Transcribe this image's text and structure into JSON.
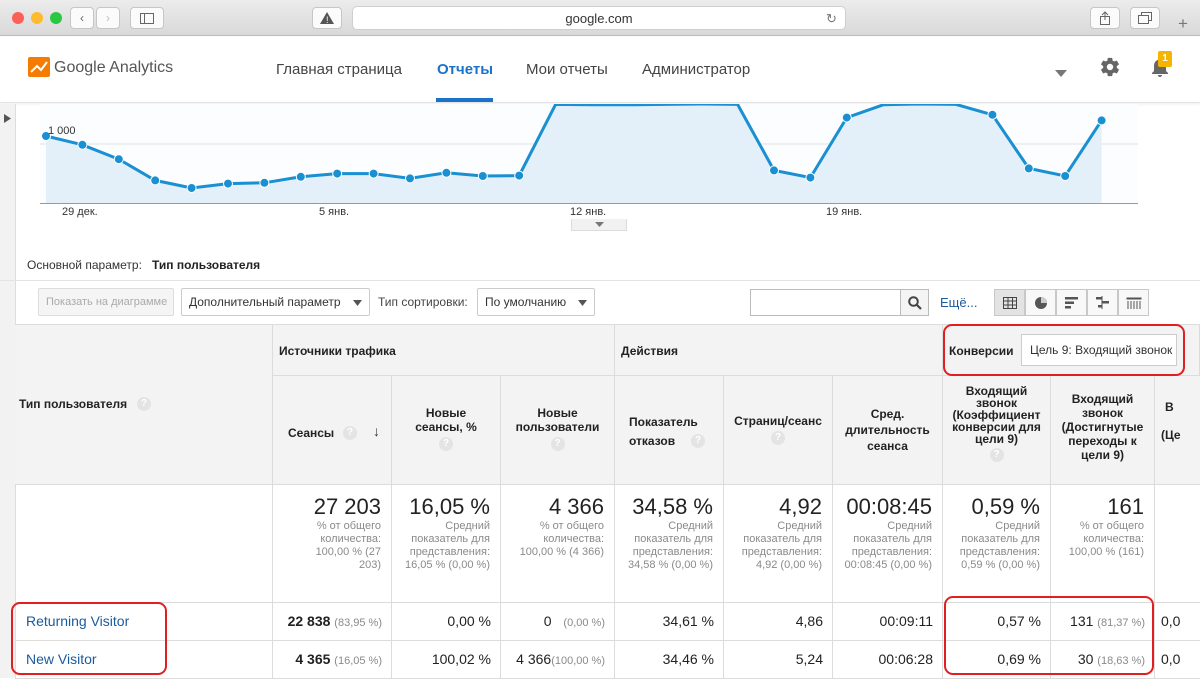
{
  "browser": {
    "url": "google.com"
  },
  "header": {
    "logo_text": "Google Analytics",
    "nav": [
      "Главная страница",
      "Отчеты",
      "Мои отчеты",
      "Администратор"
    ],
    "active_nav": "Отчеты",
    "notification_count": "1"
  },
  "chart_data": {
    "type": "line",
    "x_tick_labels": [
      "29 дек.",
      "5 янв.",
      "12 янв.",
      "19 янв."
    ],
    "y_tick_labels": [
      "1 000"
    ],
    "series": [
      {
        "values": [
          1020,
          998,
          962,
          909,
          890,
          901,
          903,
          918,
          926,
          926,
          914,
          928,
          920,
          921,
          1099,
          1098,
          1098,
          1099,
          1106,
          1099,
          934,
          916,
          1066,
          1098,
          1109,
          1099,
          1073,
          939,
          920,
          1059
        ]
      }
    ],
    "ylim": [
      850,
      1100
    ],
    "color": "#1a8fd1"
  },
  "dimension": {
    "label": "Основной параметр:",
    "value": "Тип пользователя"
  },
  "toolbar": {
    "plot_rows": "Показать на диаграмме",
    "secondary_dim": "Дополнительный параметр",
    "sort_label": "Тип сортировки:",
    "sort_value": "По умолчанию",
    "search_placeholder": "",
    "more": "Ещё..."
  },
  "table": {
    "dim_header": "Тип пользователя",
    "groups": {
      "acquisition": "Источники трафика",
      "behavior": "Действия",
      "conversions": "Конверсии",
      "goal_select": "Цель 9: Входящий звонок"
    },
    "columns": {
      "sessions": "Сеансы",
      "new_sessions": "Новые сеансы, %",
      "new_users": "Новые пользователи",
      "bounce": "Показатель отказов",
      "pages": "Страниц/сеанс",
      "duration": "Сред. длительность сеанса",
      "conv_rate": "Входящий звонок (Коэффициент конверсии для цели 9)",
      "completions": "Входящий звонок (Достигнутые переходы к цели 9)",
      "value_partial_b": "В",
      "value_partial_c": "(Це"
    },
    "totals": {
      "sessions": "27 203",
      "sessions_note": "% от общего количества: 100,00 % (27 203)",
      "new_sessions": "16,05 %",
      "new_sessions_note": "Средний показатель для представления: 16,05 % (0,00 %)",
      "new_users": "4 366",
      "new_users_note": "% от общего количества: 100,00 % (4 366)",
      "bounce": "34,58 %",
      "bounce_note": "Средний показатель для представления: 34,58 % (0,00 %)",
      "pages": "4,92",
      "pages_note": "Средний показатель для представления: 4,92 (0,00 %)",
      "duration": "00:08:45",
      "duration_note": "Средний показатель для представления: 00:08:45 (0,00 %)",
      "conv_rate": "0,59 %",
      "conv_rate_note": "Средний показатель для представления: 0,59 % (0,00 %)",
      "completions": "161",
      "completions_note": "% от общего количества: 100,00 % (161)"
    },
    "rows": [
      {
        "name": "Returning Visitor",
        "sessions": "22 838",
        "sessions_pct": "(83,95 %)",
        "new_sessions": "0,00 %",
        "new_users": "0",
        "new_users_pct": "(0,00 %)",
        "bounce": "34,61 %",
        "pages": "4,86",
        "duration": "00:09:11",
        "conv_rate": "0,57 %",
        "completions": "131",
        "completions_pct": "(81,37 %)",
        "partial": "0,0"
      },
      {
        "name": "New Visitor",
        "sessions": "4 365",
        "sessions_pct": "(16,05 %)",
        "new_sessions": "100,02 %",
        "new_users": "4 366",
        "new_users_pct": "(100,00 %)",
        "bounce": "34,46 %",
        "pages": "5,24",
        "duration": "00:06:28",
        "conv_rate": "0,69 %",
        "completions": "30",
        "completions_pct": "(18,63 %)",
        "partial": "0,0"
      }
    ]
  }
}
